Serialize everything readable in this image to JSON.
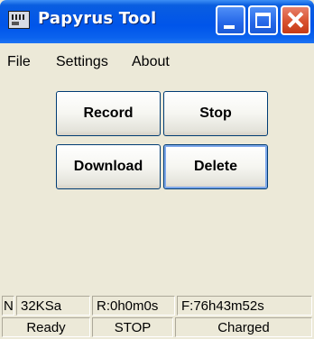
{
  "window": {
    "title": "Papyrus Tool",
    "icon": "app-window-icon"
  },
  "titlebar_buttons": {
    "minimize": "minimize-icon",
    "maximize": "maximize-icon",
    "close": "close-icon"
  },
  "menu": {
    "items": [
      {
        "label": "File"
      },
      {
        "label": "Settings"
      },
      {
        "label": "About"
      }
    ]
  },
  "buttons": {
    "record": "Record",
    "stop": "Stop",
    "download": "Download",
    "delete": "Delete"
  },
  "status": {
    "row1": {
      "mode": "N",
      "rate": "32KSa",
      "recorded": "R:0h0m0s",
      "free": "F:76h43m52s"
    },
    "row2": {
      "ready": "Ready",
      "state": "STOP",
      "battery": "Charged"
    }
  },
  "colors": {
    "titlebar": "#0055ea",
    "close_button": "#d8522f",
    "window_bg": "#ece9d8"
  }
}
